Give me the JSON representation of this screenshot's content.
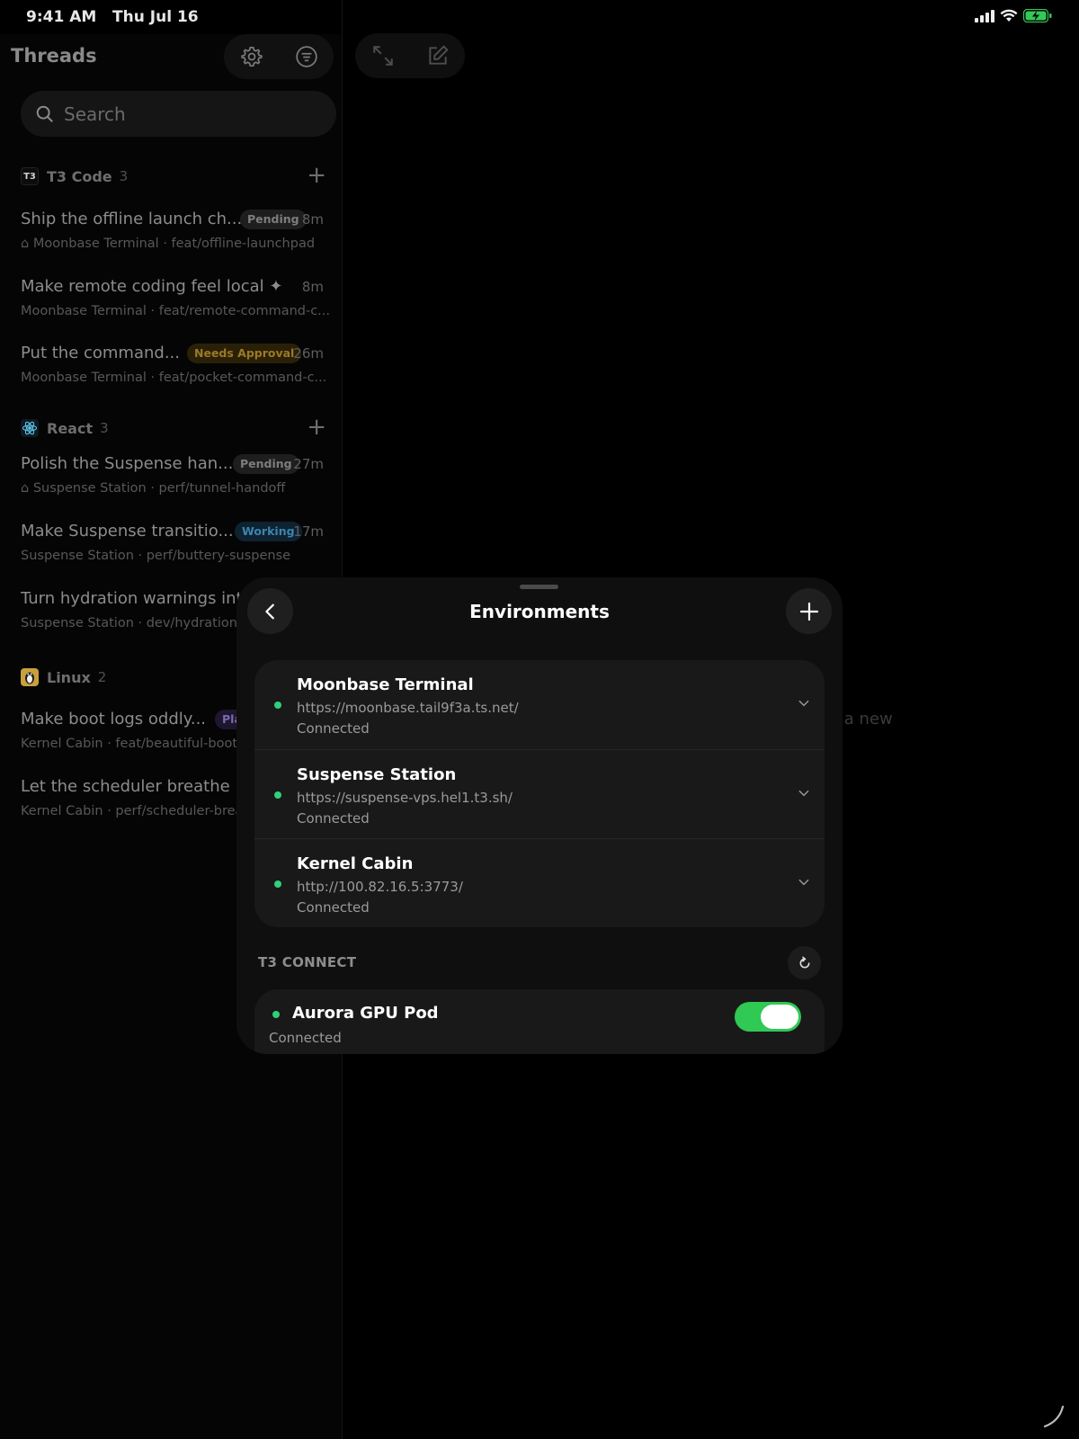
{
  "status_bar": {
    "time": "9:41 AM",
    "date": "Thu Jul 16"
  },
  "sidebar": {
    "title": "Threads",
    "search_placeholder": "Search",
    "groups": [
      {
        "icon_text": "T3",
        "name": "T3 Code",
        "count": "3",
        "threads": [
          {
            "title": "Ship the offline launch ch...",
            "badge": "Pending",
            "time": "8m",
            "subtitle": "⌂ Moonbase Terminal · feat/offline-launchpad"
          },
          {
            "title": "Make remote coding feel local ✦",
            "badge": "",
            "time": "8m",
            "subtitle": "Moonbase Terminal · feat/remote-command-c..."
          },
          {
            "title": "Put the command...",
            "badge": "Needs Approval",
            "time": "26m",
            "subtitle": "Moonbase Terminal · feat/pocket-command-c..."
          }
        ]
      },
      {
        "icon_text": "",
        "name": "React",
        "count": "3",
        "threads": [
          {
            "title": "Polish the Suspense han...",
            "badge": "Pending",
            "time": "27m",
            "subtitle": "⌂ Suspense Station · perf/tunnel-handoff"
          },
          {
            "title": "Make Suspense transitio...",
            "badge": "Working",
            "time": "17m",
            "subtitle": "Suspense Station · perf/buttery-suspense"
          },
          {
            "title": "Turn hydration warnings into",
            "badge": "",
            "time": "",
            "subtitle": "Suspense Station · dev/hydration-"
          }
        ]
      },
      {
        "icon_text": "",
        "name": "Linux",
        "count": "2",
        "threads": [
          {
            "title": "Make boot logs oddly...",
            "badge": "Pla",
            "time": "",
            "subtitle": "Kernel Cabin · feat/beautiful-boot"
          },
          {
            "title": "Let the scheduler breathe",
            "badge": "",
            "time": "",
            "subtitle": "Kernel Cabin · perf/scheduler-brea"
          }
        ]
      }
    ]
  },
  "background_hint": "t a new",
  "sheet": {
    "title": "Environments",
    "environments": [
      {
        "name": "Moonbase Terminal",
        "url": "https://moonbase.tail9f3a.ts.net/",
        "status": "Connected"
      },
      {
        "name": "Suspense Station",
        "url": "https://suspense-vps.hel1.t3.sh/",
        "status": "Connected"
      },
      {
        "name": "Kernel Cabin",
        "url": "http://100.82.16.5:3773/",
        "status": "Connected"
      }
    ],
    "section_label": "T3 CONNECT",
    "pods": [
      {
        "name": "Aurora GPU Pod",
        "status": "Connected",
        "enabled": true
      }
    ]
  },
  "colors": {
    "connected_dot": "#2fd07a",
    "toggle_on": "#2fc954",
    "battery": "#34c759"
  }
}
